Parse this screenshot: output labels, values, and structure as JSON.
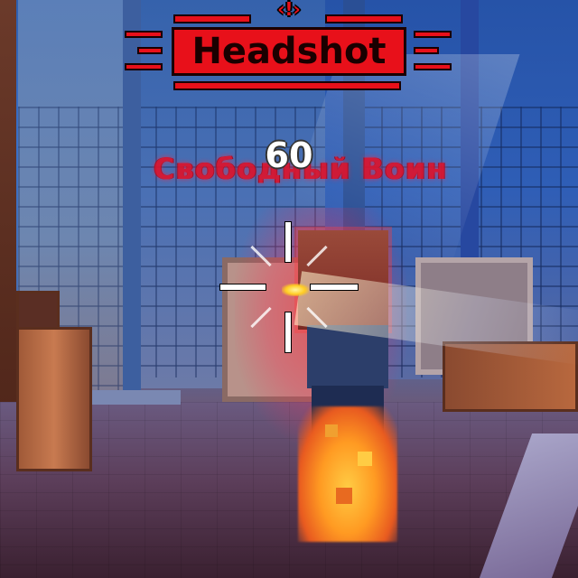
{
  "hud": {
    "kill_banner": {
      "label": "Headshot",
      "color": "#e8101a"
    },
    "damage_number": "60",
    "target_name": "Свободный Воин",
    "crosshair": {
      "color": "#ffffff"
    }
  },
  "scene": {
    "sky_color": "#3a70c8",
    "target_glow_color": "#ff283c"
  }
}
